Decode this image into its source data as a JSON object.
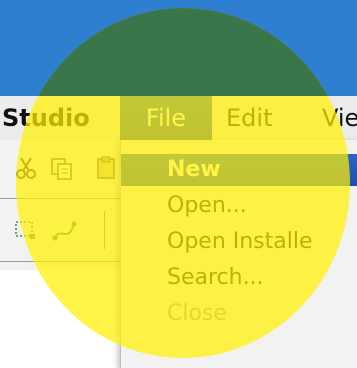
{
  "menubar": {
    "app_name": "Studio",
    "file": "File",
    "edit": "Edit",
    "view": "Vie"
  },
  "file_menu": {
    "items": [
      {
        "label": "New",
        "state": "selected"
      },
      {
        "label": "Open...",
        "state": "normal"
      },
      {
        "label": "Open Installe",
        "state": "normal"
      },
      {
        "label": "Search...",
        "state": "normal"
      },
      {
        "label": "Close",
        "state": "disabled"
      }
    ]
  },
  "toolbar": {
    "icons": [
      "cut-icon",
      "copy-icon",
      "paste-icon",
      "selection-icon",
      "curve-icon"
    ]
  },
  "colors": {
    "desktop_blue": "#2f7fd1",
    "menu_selection": "#2a63c9",
    "highlight_yellow": "#fff000",
    "highlight_green": "#005050"
  }
}
